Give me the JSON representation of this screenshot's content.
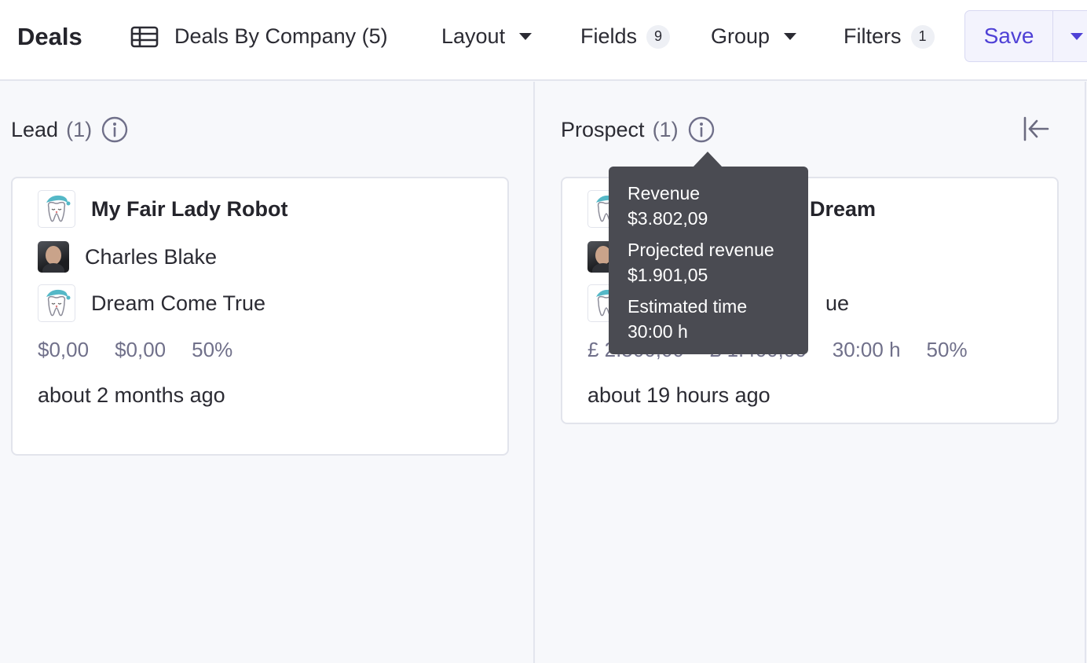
{
  "header": {
    "title": "Deals",
    "view_name": "Deals By Company (5)",
    "layout_label": "Layout",
    "fields_label": "Fields",
    "fields_count": "9",
    "group_label": "Group",
    "filters_label": "Filters",
    "filters_count": "1",
    "save_label": "Save"
  },
  "columns": [
    {
      "name": "Lead",
      "count": "(1)",
      "cards": [
        {
          "deal": "My Fair Lady Robot",
          "contact": "Charles Blake",
          "company": "Dream Come True",
          "revenue": "$0,00",
          "projected_revenue": "$0,00",
          "probability": "50%",
          "updated": "about 2 months ago"
        }
      ]
    },
    {
      "name": "Prospect",
      "count": "(1)",
      "cards": [
        {
          "deal": "Dream",
          "company": "ue",
          "revenue": "£ 2.500,00",
          "projected_revenue": "£ 1.400,00",
          "estimated_time": "30:00 h",
          "probability": "50%",
          "updated": "about 19 hours ago"
        }
      ]
    }
  ],
  "tooltip": {
    "revenue_label": "Revenue",
    "revenue_value": "$3.802,09",
    "projected_label": "Projected revenue",
    "projected_value": "$1.901,05",
    "time_label": "Estimated time",
    "time_value": "30:00 h"
  },
  "colors": {
    "accent": "#4f41d6",
    "tooltip_bg": "#4a4b52",
    "board_bg": "#f7f8fb",
    "muted_text": "#70708a"
  },
  "icons": {
    "view": "table-icon",
    "info": "info-circle-icon",
    "collapse": "collapse-left-icon",
    "company_logo": "sleepy-tooth-logo"
  }
}
